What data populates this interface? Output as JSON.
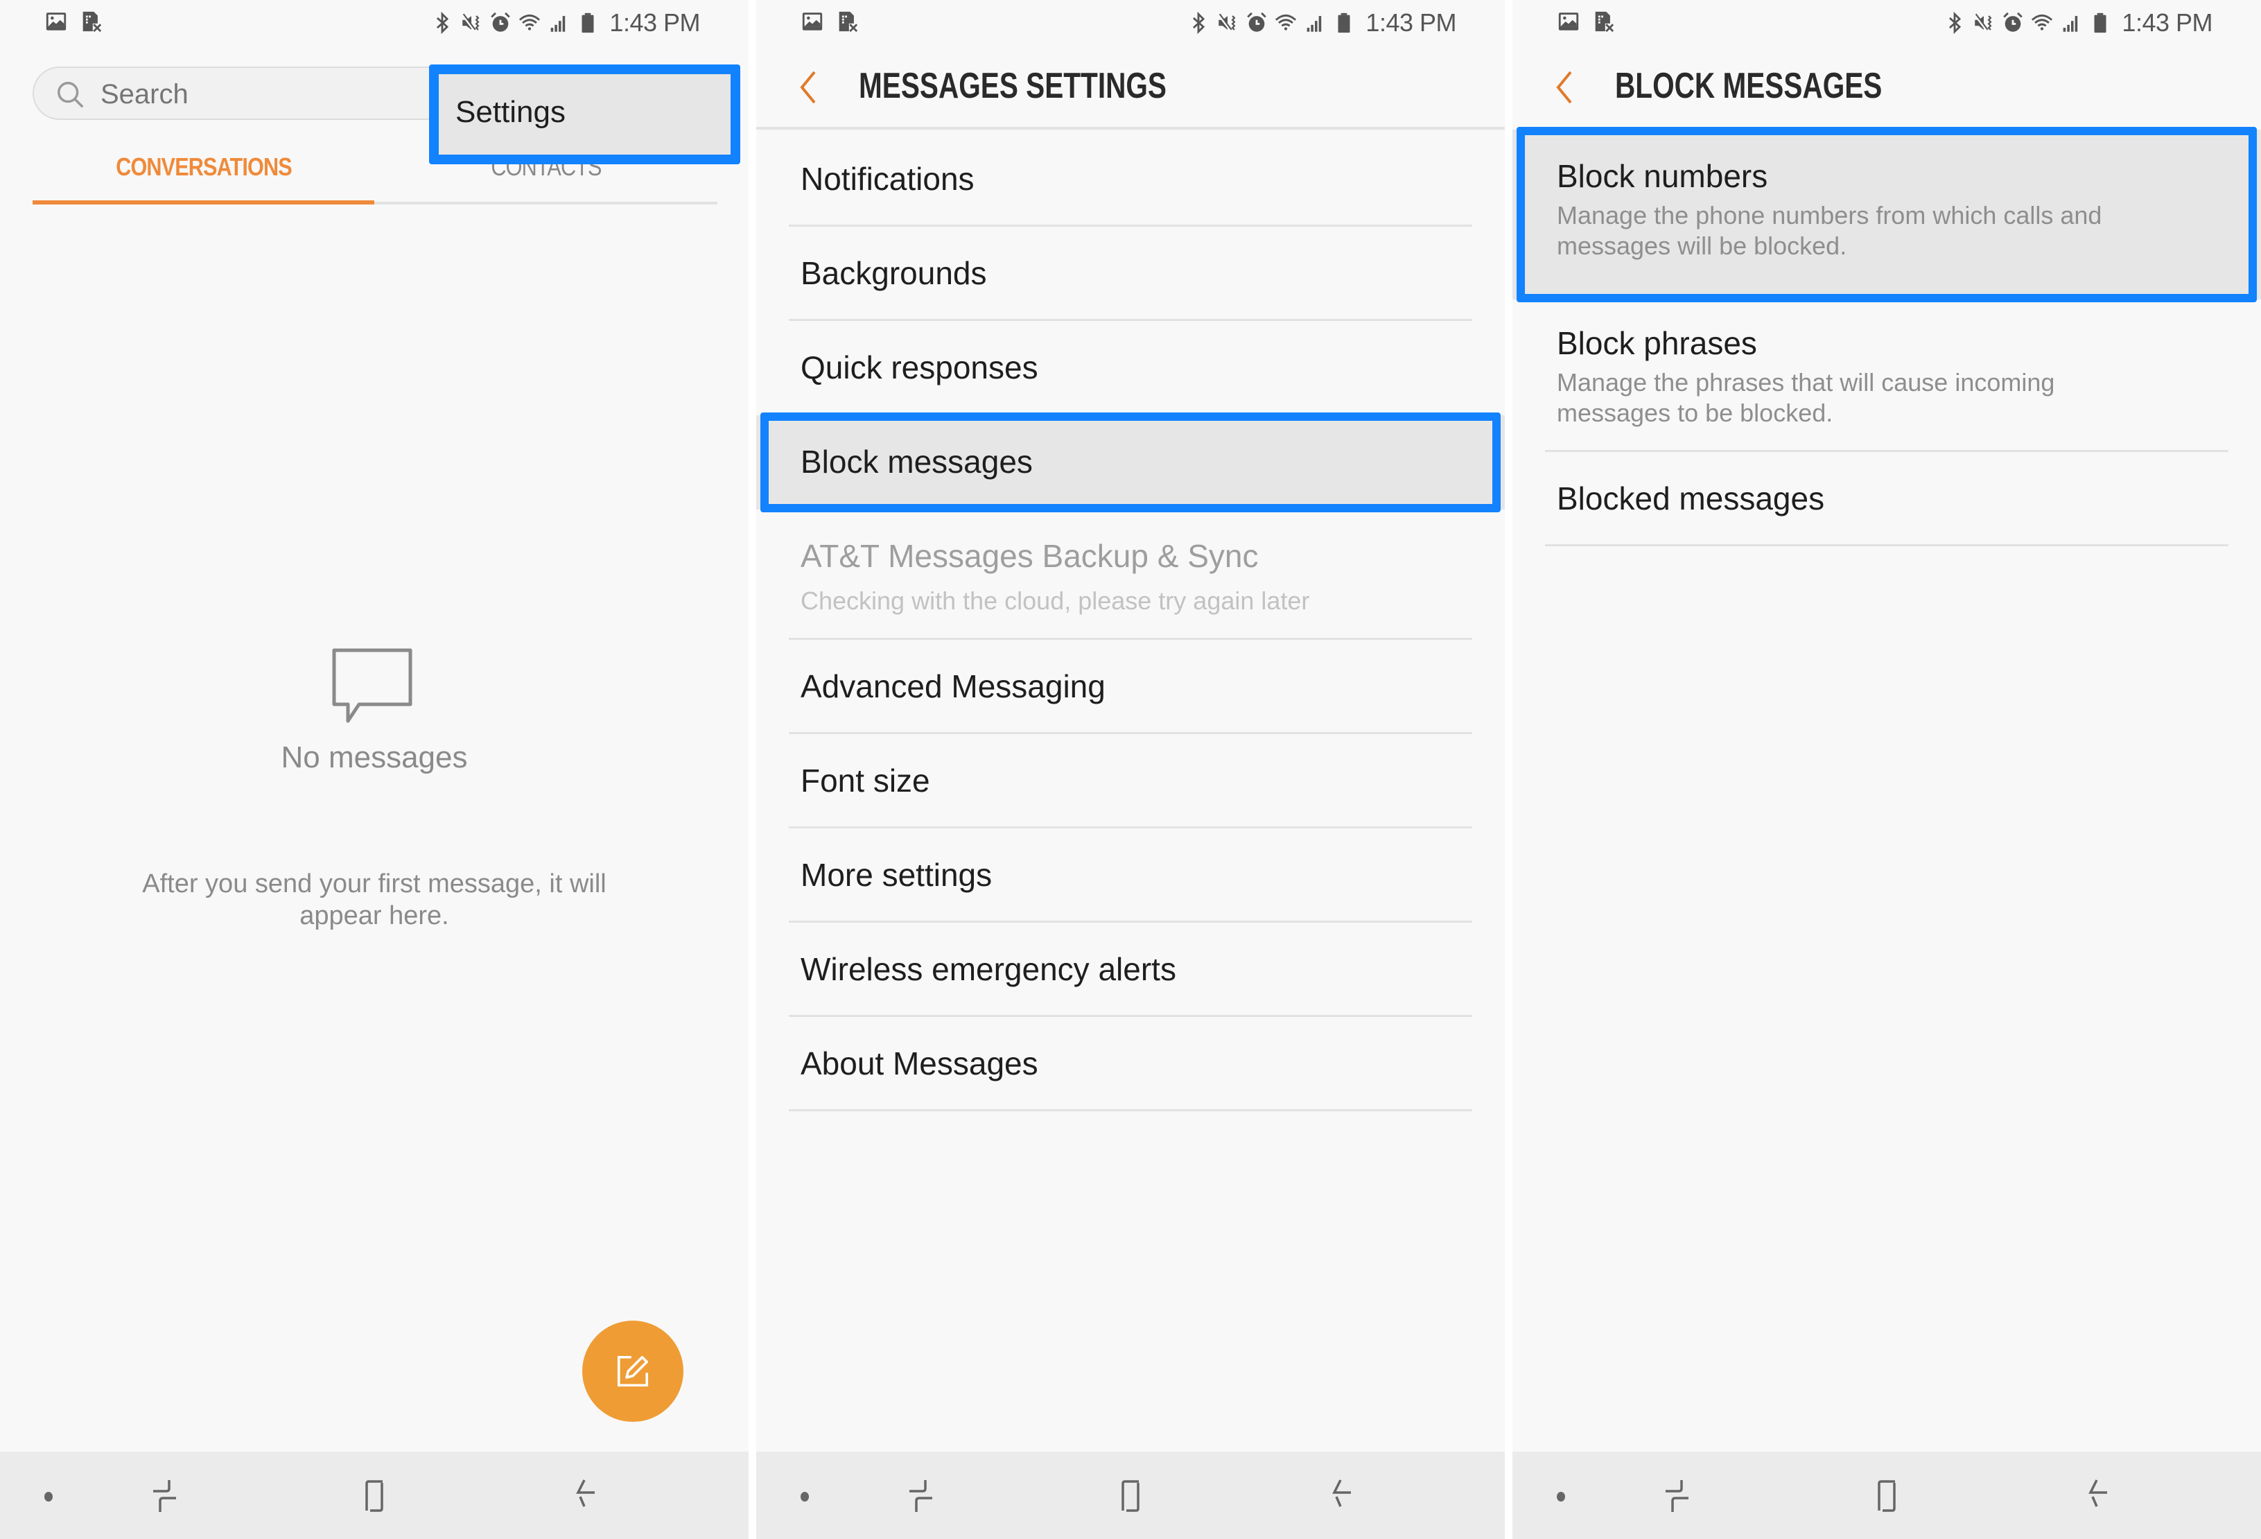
{
  "status_bar": {
    "time": "1:43 PM",
    "left_icons": [
      "image-icon",
      "no-sim-icon"
    ],
    "right_icons": [
      "bluetooth-icon",
      "mute-vibrate-icon",
      "alarm-icon",
      "wifi-icon",
      "signal-icon",
      "battery-icon"
    ]
  },
  "conversations_screen": {
    "search_placeholder": "Search",
    "tabs": [
      {
        "label": "CONVERSATIONS",
        "active": true
      },
      {
        "label": "CONTACTS",
        "active": false
      }
    ],
    "overflow_menu": {
      "items": [
        {
          "label": "Settings",
          "highlighted": true
        }
      ]
    },
    "empty_state": {
      "title": "No messages",
      "body": "After you send your first message, it will appear here."
    },
    "fab": {
      "icon": "compose-icon",
      "label": "Compose"
    }
  },
  "messages_settings_screen": {
    "title": "MESSAGES SETTINGS",
    "items": [
      {
        "title": "Notifications"
      },
      {
        "title": "Backgrounds"
      },
      {
        "title": "Quick responses"
      },
      {
        "title": "Block messages",
        "highlighted": true
      },
      {
        "title": "AT&T Messages Backup & Sync",
        "subtitle": "Checking with the cloud, please try again later",
        "disabled": true
      },
      {
        "title": "Advanced Messaging"
      },
      {
        "title": "Font size"
      },
      {
        "title": "More settings"
      },
      {
        "title": "Wireless emergency alerts"
      },
      {
        "title": "About Messages"
      }
    ]
  },
  "block_messages_screen": {
    "title": "BLOCK MESSAGES",
    "items": [
      {
        "title": "Block numbers",
        "subtitle": "Manage the phone numbers from which calls and messages will be blocked.",
        "highlighted": true
      },
      {
        "title": "Block phrases",
        "subtitle": "Manage the phrases that will cause incoming messages to be blocked."
      },
      {
        "title": "Blocked messages"
      }
    ]
  },
  "nav_bar": {
    "buttons": [
      "dot-indicator",
      "recent-apps",
      "home",
      "back"
    ]
  },
  "colors": {
    "accent": "#ef8a3a",
    "fab": "#ef9c35",
    "highlight_border": "#1282ff",
    "background": "#f8f8f8",
    "nav_bar": "#ebebeb"
  }
}
